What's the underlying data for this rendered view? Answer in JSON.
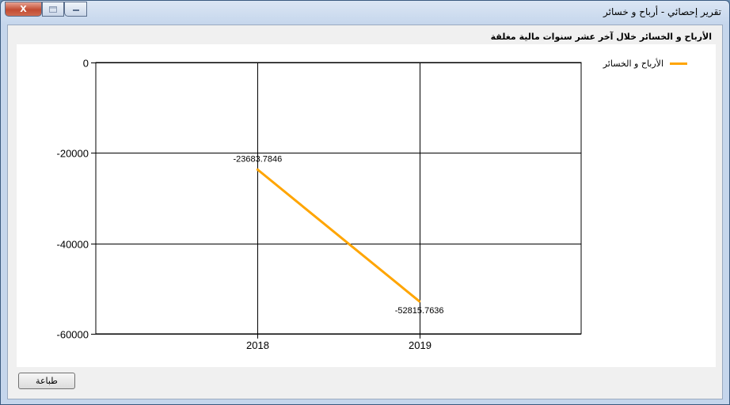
{
  "window": {
    "title": "تقرير إحصائي - أرباح و خسائر",
    "close_label": "X"
  },
  "report": {
    "heading": "الأرباح و الخسائر خلال آخر عشر سنوات مالية مغلقة"
  },
  "chart_data": {
    "type": "line",
    "categories": [
      "2018",
      "2019"
    ],
    "series": [
      {
        "name": "الأرباح و الخسائر",
        "values": [
          -23683.7846,
          -52815.7636
        ],
        "color": "#ffa500"
      }
    ],
    "ylim": [
      -60000,
      0
    ],
    "y_ticks": [
      "0",
      "-20000",
      "-40000",
      "-60000"
    ],
    "grid": true,
    "legend_position": "top-right"
  },
  "footer": {
    "print_label": "طباعة"
  }
}
